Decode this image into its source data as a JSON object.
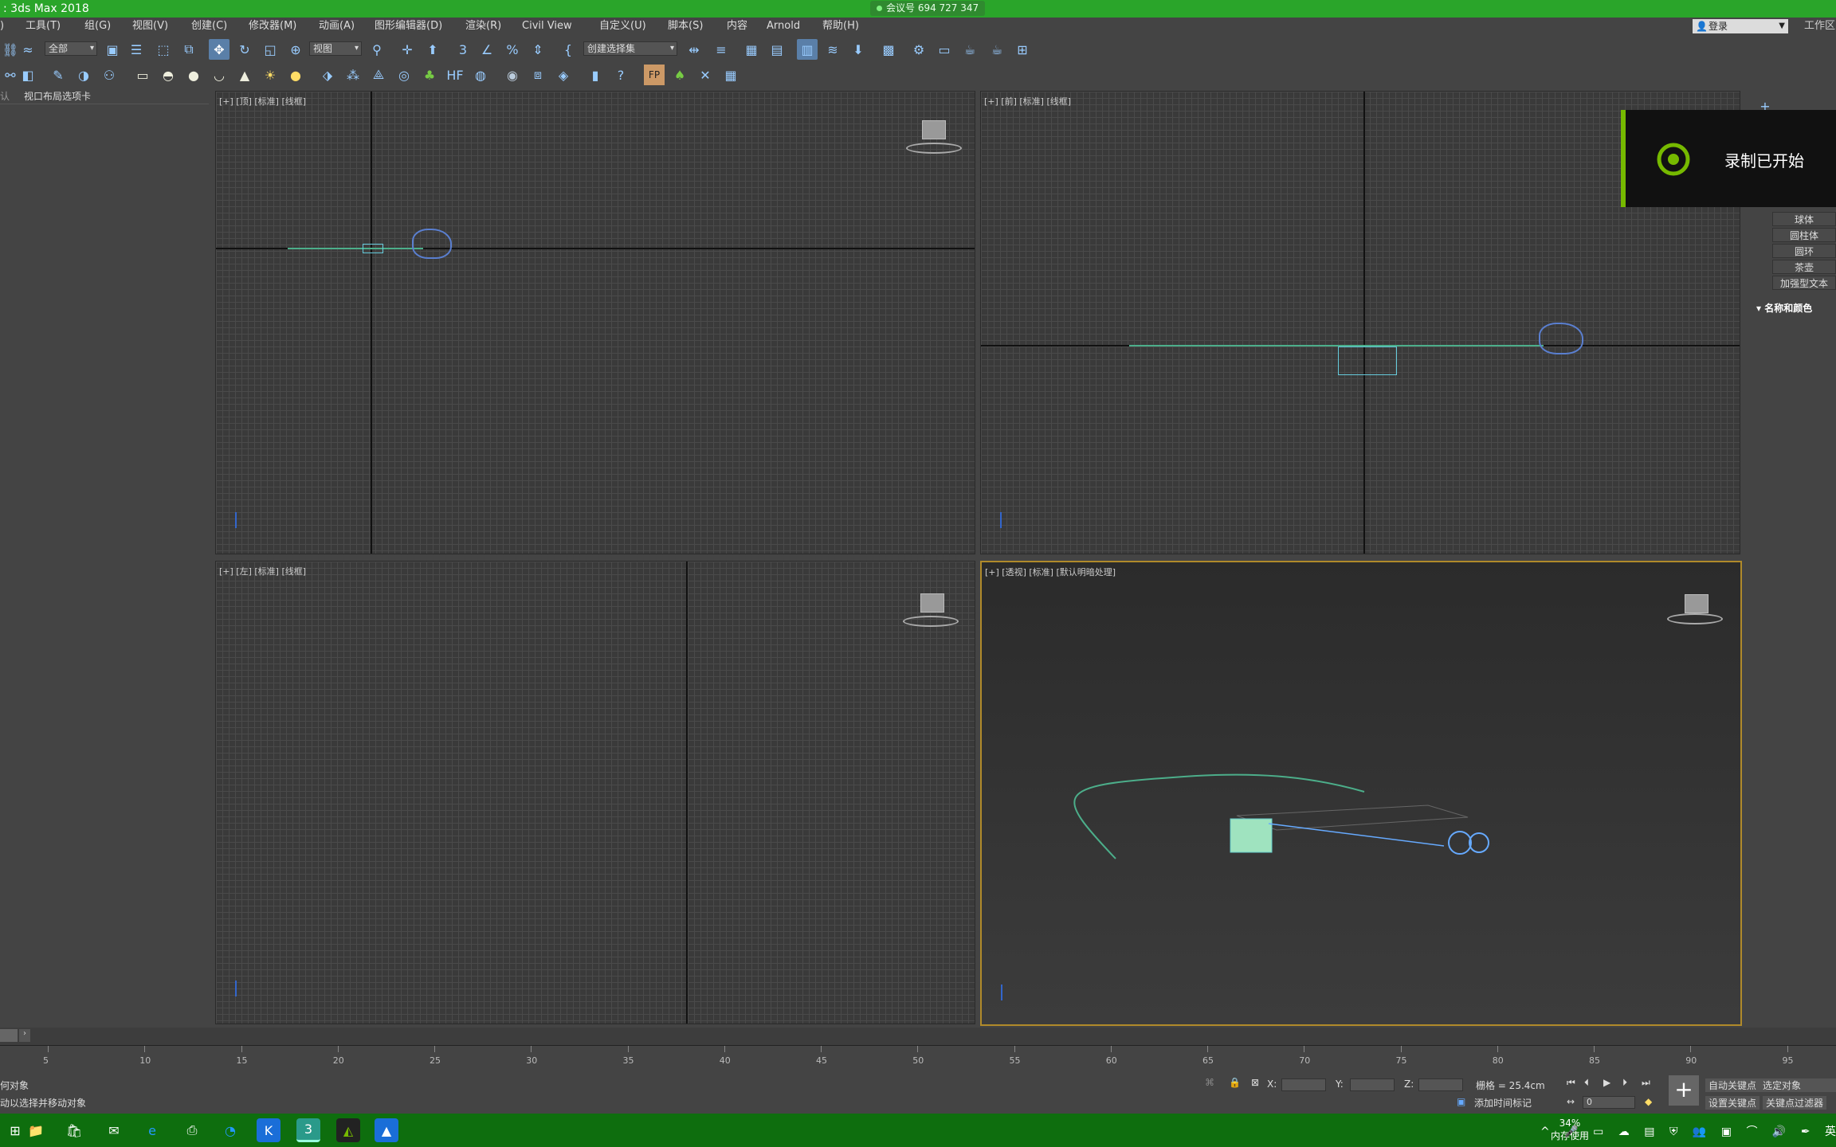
{
  "title": {
    "app": ": 3ds Max 2018",
    "meeting": "会议号 694 727 347"
  },
  "menu": [
    "工具(T)",
    "组(G)",
    "视图(V)",
    "创建(C)",
    "修改器(M)",
    "动画(A)",
    "图形编辑器(D)",
    "渲染(R)",
    "Civil View",
    "自定义(U)",
    "脚本(S)",
    "内容",
    "Arnold",
    "帮助(H)"
  ],
  "login": "登录",
  "workspace": "工作区",
  "toolbar": {
    "filter": "全部",
    "refcoord": "视图",
    "selset": "创建选择集"
  },
  "leftpanel": {
    "tab0": "认",
    "tab1": "视口布局选项卡"
  },
  "viewports": {
    "top": "[+] [顶] [标准] [线框]",
    "front": "[+] [前] [标准] [线框]",
    "left": "[+] [左] [标准] [线框]",
    "persp": "[+] [透视] [标准] [默认明暗处理]"
  },
  "rightpanel": {
    "items": [
      "球体",
      "圆柱体",
      "圆环",
      "茶壶",
      "加强型文本"
    ],
    "group": "名称和颜色"
  },
  "recording": "录制已开始",
  "timeline": {
    "ticks": [
      "5",
      "10",
      "15",
      "20",
      "25",
      "30",
      "35",
      "40",
      "45",
      "50",
      "55",
      "60",
      "65",
      "70",
      "75",
      "80",
      "85",
      "90",
      "95"
    ]
  },
  "status": {
    "line1": "何对象",
    "line2": "动以选择并移动对象",
    "x": "X:",
    "y": "Y:",
    "z": "Z:",
    "grid": "栅格 = 25.4cm",
    "addtime": "添加时间标记",
    "autokey": "自动关键点",
    "setkey": "设置关键点",
    "selobj": "选定对象",
    "keyfilter": "关键点过滤器",
    "frame": "0"
  },
  "taskbar": {
    "mem": "34%",
    "memlabel": "内存使用",
    "lang": "英"
  }
}
